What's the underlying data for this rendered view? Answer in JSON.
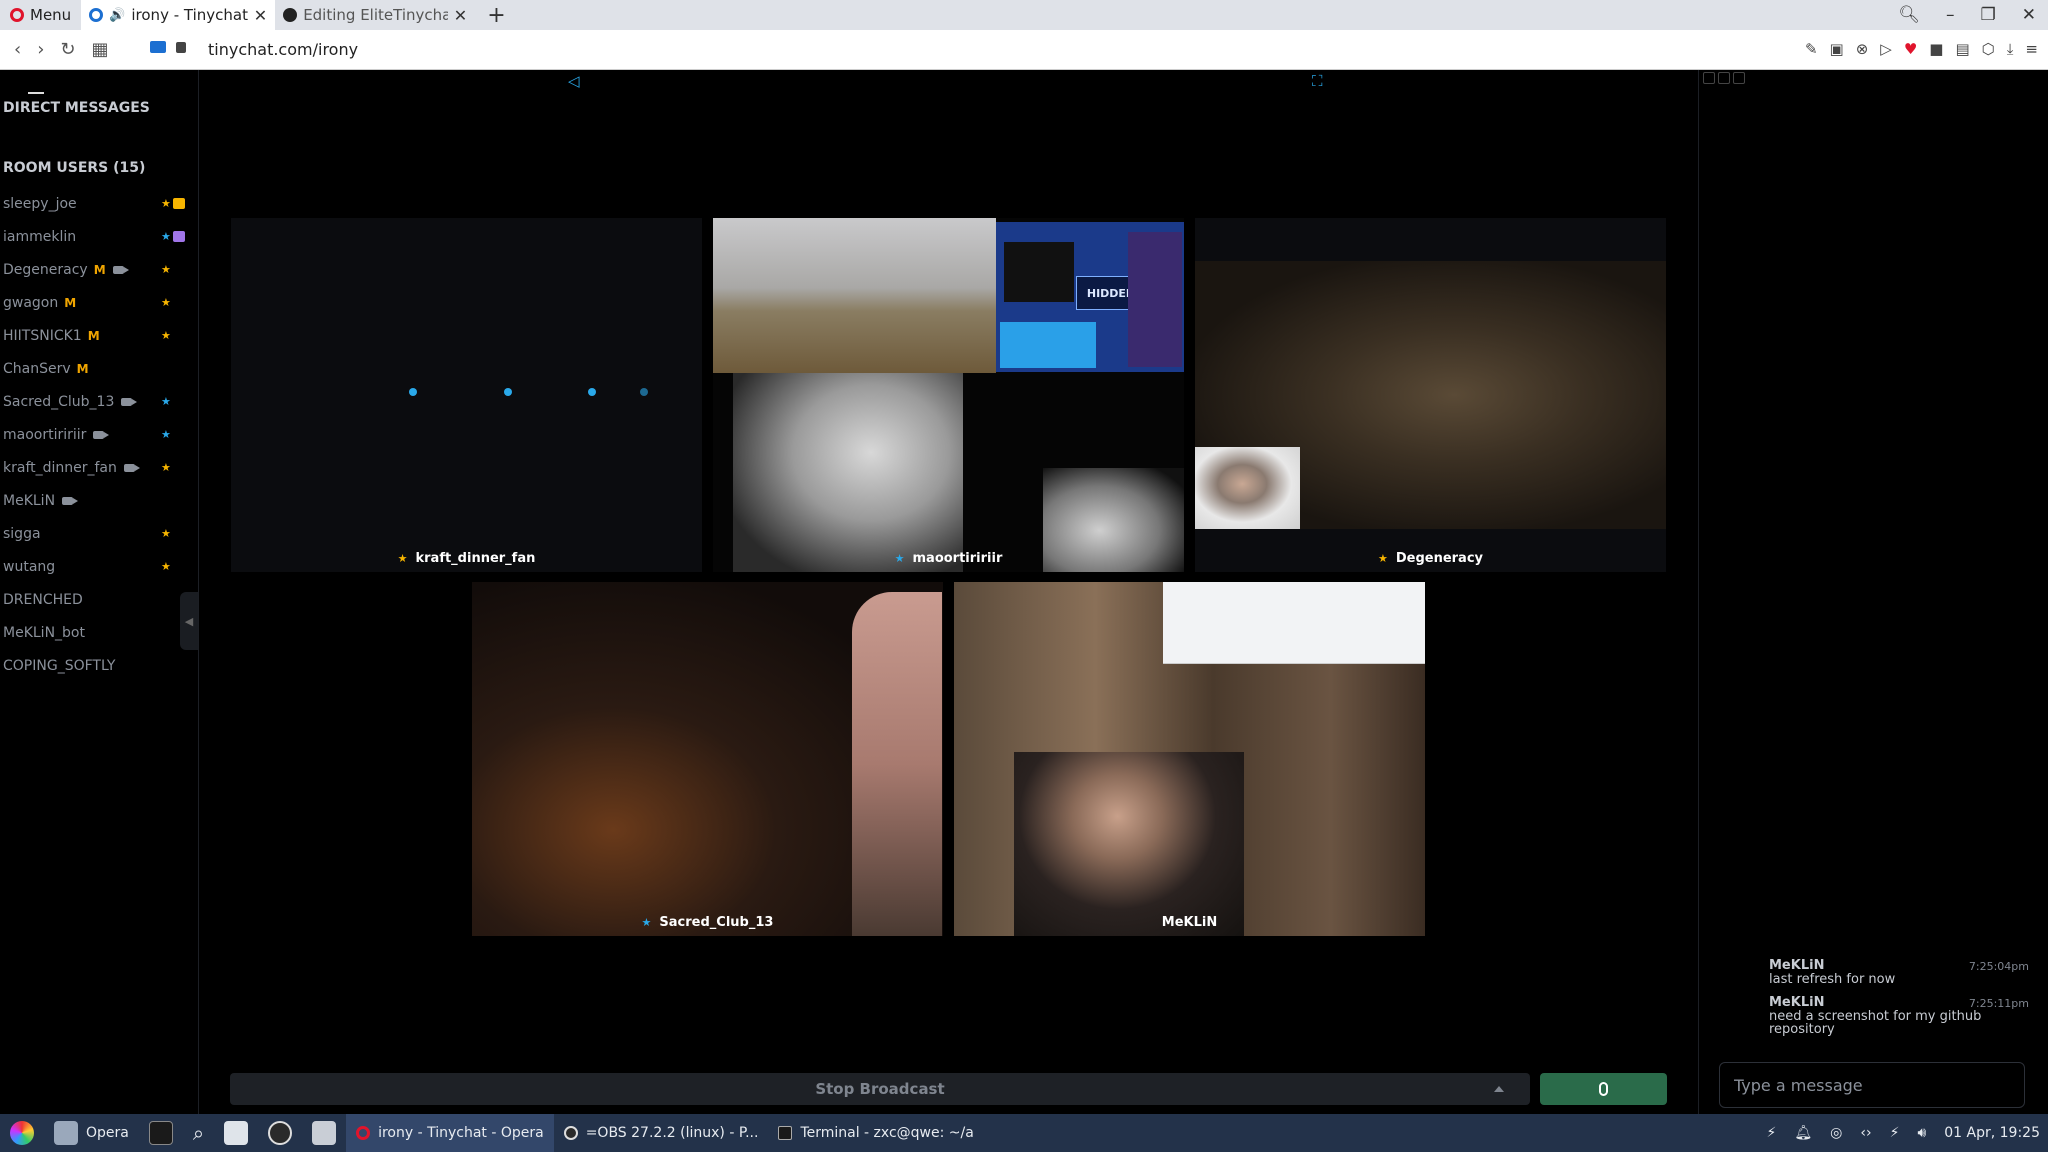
{
  "browser": {
    "menu_label": "Menu",
    "tabs": [
      {
        "title": "irony - Tinychat",
        "active": true
      },
      {
        "title": "Editing EliteTinychat/",
        "active": false
      }
    ],
    "url": "tinychat.com/irony"
  },
  "sidebar": {
    "direct_messages_title": "DIRECT MESSAGES",
    "room_users_title": "ROOM USERS (15)",
    "users": [
      {
        "name": "sleepy_joe",
        "moderator": false,
        "camera": false,
        "star": "gold",
        "chip": "gold"
      },
      {
        "name": "iammeklin",
        "moderator": false,
        "camera": false,
        "star": "blue",
        "chip": "purple"
      },
      {
        "name": "Degeneracy",
        "moderator": true,
        "camera": true,
        "star": "gold",
        "chip": ""
      },
      {
        "name": "gwagon",
        "moderator": true,
        "camera": false,
        "star": "gold",
        "chip": ""
      },
      {
        "name": "HIITSNICK1",
        "moderator": true,
        "camera": false,
        "star": "gold",
        "chip": ""
      },
      {
        "name": "ChanServ",
        "moderator": true,
        "camera": false,
        "star": "",
        "chip": ""
      },
      {
        "name": "Sacred_Club_13",
        "moderator": false,
        "camera": true,
        "star": "blue",
        "chip": ""
      },
      {
        "name": "maoortiririir",
        "moderator": false,
        "camera": true,
        "star": "blue",
        "chip": ""
      },
      {
        "name": "kraft_dinner_fan",
        "moderator": false,
        "camera": true,
        "star": "gold",
        "chip": ""
      },
      {
        "name": "MeKLiN",
        "moderator": false,
        "camera": true,
        "star": "",
        "chip": ""
      },
      {
        "name": "sigga",
        "moderator": false,
        "camera": false,
        "star": "gold",
        "chip": ""
      },
      {
        "name": "wutang",
        "moderator": false,
        "camera": false,
        "star": "gold",
        "chip": ""
      },
      {
        "name": "DRENCHED",
        "moderator": false,
        "camera": false,
        "star": "",
        "chip": ""
      },
      {
        "name": "MeKLiN_bot",
        "moderator": false,
        "camera": false,
        "star": "",
        "chip": ""
      },
      {
        "name": "COPING_SOFTLY",
        "moderator": false,
        "camera": false,
        "star": "",
        "chip": ""
      }
    ],
    "moderator_badge": "M"
  },
  "videos": [
    {
      "name": "kraft_dinner_fan",
      "star": "gold"
    },
    {
      "name": "maoortiririir",
      "star": "blue"
    },
    {
      "name": "Degeneracy",
      "star": "gold"
    },
    {
      "name": "Sacred_Club_13",
      "star": "blue"
    },
    {
      "name": "MeKLiN",
      "star": ""
    }
  ],
  "screen_share_label": "HIDDEN",
  "broadcast": {
    "label": "Stop Broadcast"
  },
  "chat": {
    "messages": [
      {
        "author": "MeKLiN",
        "time": "7:25:04pm",
        "text": "last refresh for now"
      },
      {
        "author": "MeKLiN",
        "time": "7:25:11pm",
        "text": "need a screenshot for my github repository"
      }
    ],
    "input_placeholder": "Type a message"
  },
  "taskbar": {
    "items": [
      {
        "label": "Opera",
        "active": false
      },
      {
        "label": "irony - Tinychat - Opera",
        "active": true
      },
      {
        "label": "=OBS 27.2.2 (linux) - P...",
        "active": false
      },
      {
        "label": "Terminal - zxc@qwe: ~/a",
        "active": false
      }
    ],
    "clock": "01 Apr, 19:25"
  },
  "colors": {
    "accent_blue": "#2aa9ea",
    "star_gold": "#f7b500",
    "mic_green": "#2a6b4a"
  }
}
